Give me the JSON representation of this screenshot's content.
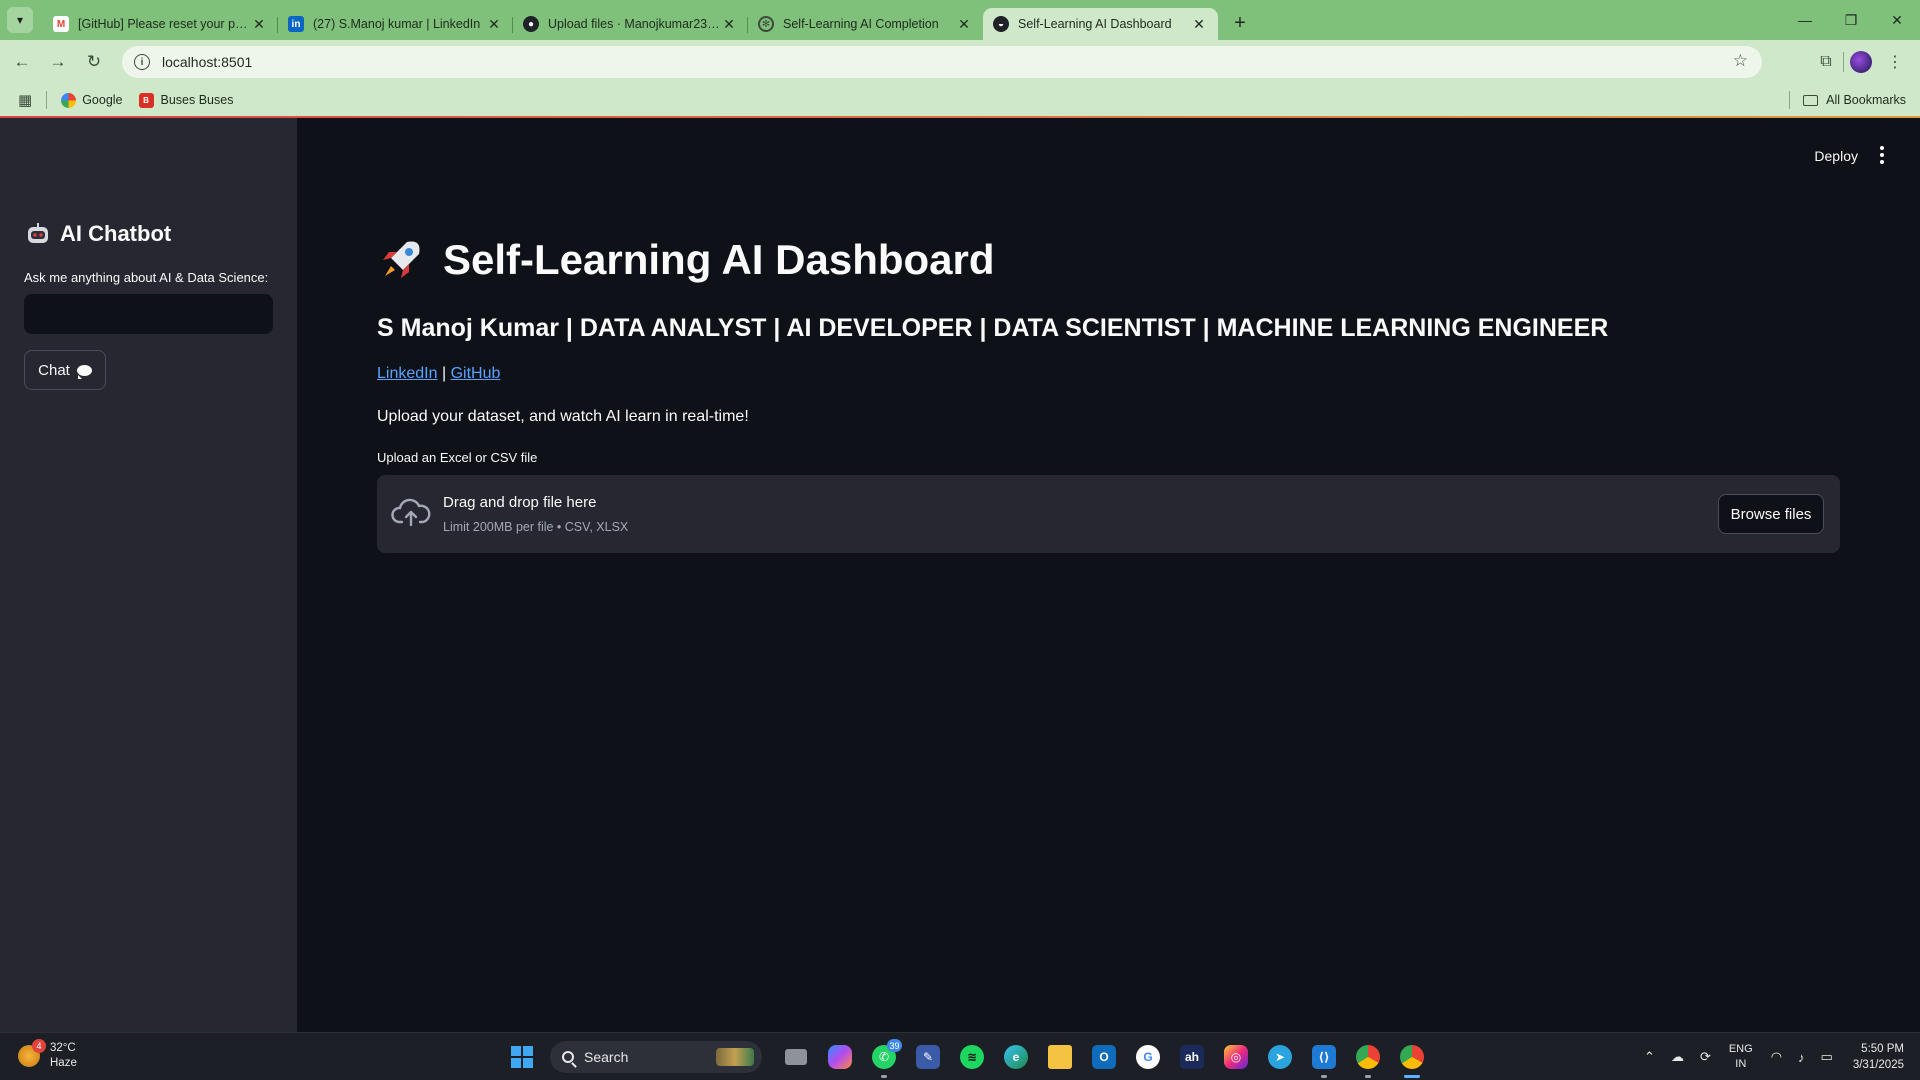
{
  "browser": {
    "tabs": [
      {
        "title": "[GitHub] Please reset your password",
        "favicon": "gmail-icon",
        "active": false
      },
      {
        "title": "(27) S.Manoj kumar | LinkedIn",
        "favicon": "linkedin-icon",
        "active": false
      },
      {
        "title": "Upload files · Manojkumar2309",
        "favicon": "github-icon",
        "active": false
      },
      {
        "title": "Self-Learning AI Completion",
        "favicon": "openai-icon",
        "active": false
      },
      {
        "title": "Self-Learning AI Dashboard",
        "favicon": "streamlit-icon",
        "active": true
      }
    ],
    "url": "localhost:8501",
    "bookmarks": [
      {
        "label": "Google",
        "icon": "google-icon"
      },
      {
        "label": "Buses Buses",
        "icon": "bus-icon"
      }
    ],
    "all_bookmarks_label": "All Bookmarks"
  },
  "sidebar": {
    "title": "AI Chatbot",
    "prompt_label": "Ask me anything about AI & Data Science:",
    "input_value": "",
    "chat_button_label": "Chat"
  },
  "header": {
    "deploy_label": "Deploy"
  },
  "main": {
    "title": "Self-Learning AI Dashboard",
    "subtitle": "S Manoj Kumar | DATA ANALYST | AI DEVELOPER | DATA SCIENTIST | MACHINE LEARNING ENGINEER",
    "links": [
      {
        "label": "LinkedIn"
      },
      {
        "label": "GitHub"
      }
    ],
    "link_separator": "|",
    "tagline": "Upload your dataset, and watch AI learn in real-time!",
    "uploader": {
      "label": "Upload an Excel or CSV file",
      "drag_text": "Drag and drop file here",
      "limit_text": "Limit 200MB per file • CSV, XLSX",
      "browse_label": "Browse files"
    }
  },
  "taskbar": {
    "weather": {
      "temp": "32°C",
      "condition": "Haze",
      "badge": "4"
    },
    "search_label": "Search",
    "whatsapp_badge": "39",
    "language": {
      "line1": "ENG",
      "line2": "IN"
    },
    "time": "5:50 PM",
    "date": "3/31/2025"
  },
  "colors": {
    "app_bg": "#0e1117",
    "sidebar_bg": "#262730",
    "link": "#5aa2ff",
    "chrome_green": "#7fc07a"
  }
}
